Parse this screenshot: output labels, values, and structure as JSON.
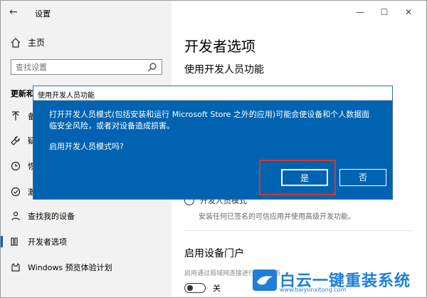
{
  "window": {
    "title": "设置",
    "back_icon": "back-arrow-icon",
    "controls": [
      "—",
      "☐",
      "✕"
    ]
  },
  "sidebar": {
    "home_label": "主页",
    "search_placeholder": "查找设置",
    "section_header": "更新和",
    "items": [
      {
        "label": "备",
        "icon": "upload-icon"
      },
      {
        "label": "疑",
        "icon": "wrench-icon"
      },
      {
        "label": "恢",
        "icon": "history-icon"
      },
      {
        "label": "激",
        "icon": "check-circle-icon"
      },
      {
        "label": "查找我的设备",
        "icon": "person-pin-icon"
      },
      {
        "label": "开发者选项",
        "icon": "developer-icon",
        "selected": true
      },
      {
        "label": "Windows 预览体验计划",
        "icon": "cat-icon"
      }
    ]
  },
  "main": {
    "title": "开发者选项",
    "subtitle": "使用开发人员功能",
    "radio_label": "开发人员模式",
    "radio_desc": "安装任何已签名的可信应用并使用高级开发功能。",
    "portal_title": "启用设备门户",
    "portal_desc": "启用通过局域网连接进行远程诊断",
    "toggle_label": "关"
  },
  "dialog": {
    "title": "使用开发人员功能",
    "message": "打开开发人员模式(包括安装和运行 Microsoft Store 之外的应用)可能会使设备和个人数据面临安全风险，或者对设备造成损害。",
    "question": "启用开发人员模式吗?",
    "yes_label": "是",
    "no_label": "否"
  },
  "watermark": {
    "text": "白云一键重装系统",
    "url": "www.baiyunxitong.com"
  }
}
